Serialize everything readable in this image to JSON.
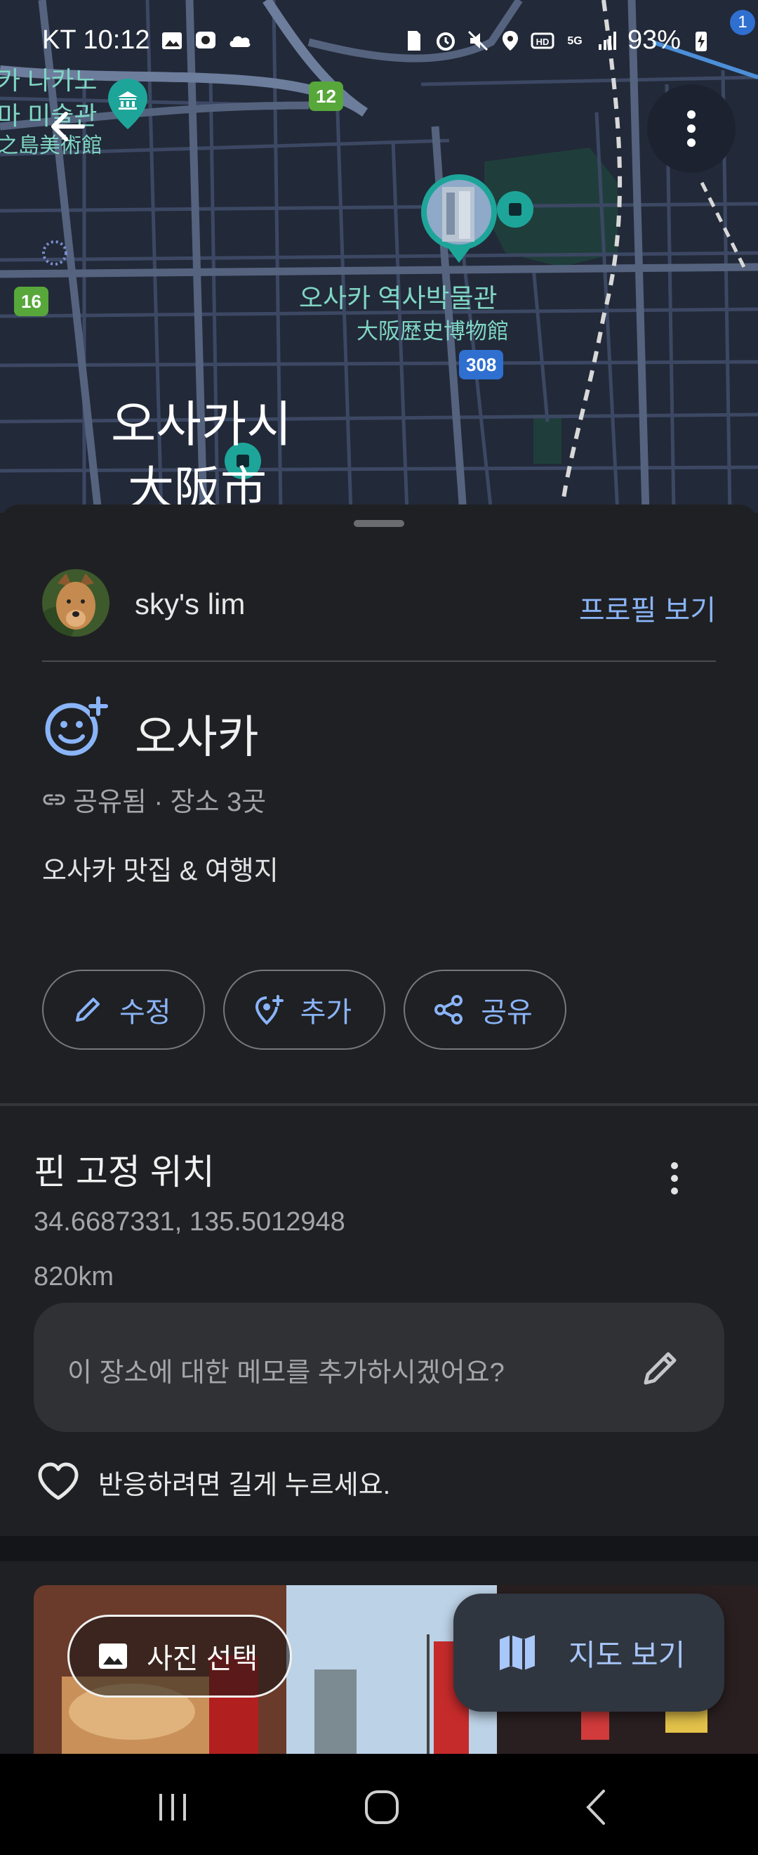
{
  "status_bar": {
    "carrier_time": "KT 10:12",
    "battery": "93%",
    "notification_count": "1",
    "icons_left": [
      "gallery-icon",
      "chat-icon",
      "cloud-icon"
    ],
    "icons_right": [
      "sim-icon",
      "alarm-icon",
      "mute-icon",
      "location-icon",
      "hd-icon",
      "5g-icon",
      "signal-icon",
      "battery-icon"
    ]
  },
  "map": {
    "label_left_1": "카 나카노",
    "label_left_2": "마 미술관",
    "label_left_3": "之島美術館",
    "museum_name_ko": "오사카 역사박물관",
    "museum_name_jp": "大阪歴史博物館",
    "city_name_ko": "오사카시",
    "city_name_jp": "大阪市",
    "route_shields": [
      "12",
      "16",
      "308"
    ]
  },
  "owner": {
    "name": "sky's lim",
    "profile_link": "프로필 보기"
  },
  "list": {
    "title": "오사카",
    "meta": "공유됨 · 장소 3곳",
    "description": "오사카 맛집 & 여행지"
  },
  "actions": {
    "edit": "수정",
    "add": "추가",
    "share": "공유"
  },
  "pin": {
    "title": "핀 고정 위치",
    "coordinates": "34.6687331, 135.5012948",
    "distance": "820km",
    "memo_placeholder": "이 장소에 대한 메모를 추가하시겠어요?",
    "react_hint": "반응하려면 길게 누르세요."
  },
  "photos": {
    "select_button": "사진 선택"
  },
  "fab": {
    "map_view": "지도 보기"
  },
  "colors": {
    "accent": "#8ab4f8",
    "map_label": "#7fd6c4",
    "sheet_bg": "#1f2023"
  }
}
